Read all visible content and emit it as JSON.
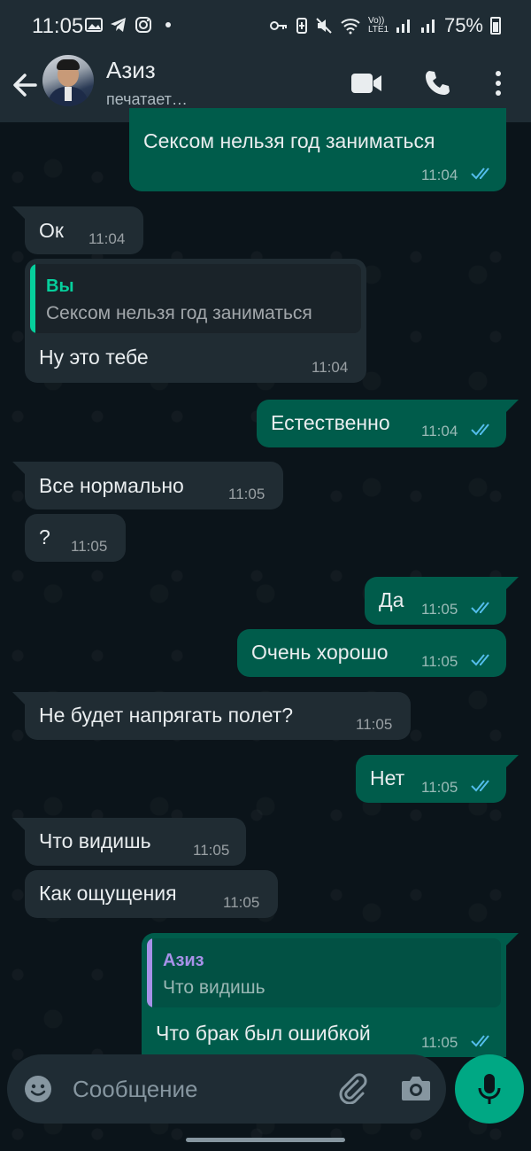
{
  "status_bar": {
    "time": "11:05",
    "battery": "75%",
    "network": "Vo)) LTE1"
  },
  "header": {
    "contact_name": "Азиз",
    "contact_status": "печатает…"
  },
  "messages": [
    {
      "dir": "out",
      "text": "Сексом нельзя год заниматься",
      "time": "11:04",
      "read": true
    },
    {
      "dir": "in",
      "text": "Ок",
      "time": "11:04"
    },
    {
      "dir": "in",
      "quote_name": "Вы",
      "quote_text": "Сексом нельзя год заниматься",
      "text": "Ну это тебе",
      "time": "11:04"
    },
    {
      "dir": "out",
      "text": "Естественно",
      "time": "11:04",
      "read": true
    },
    {
      "dir": "in",
      "text": "Все нормально",
      "time": "11:05"
    },
    {
      "dir": "in",
      "text": "?",
      "time": "11:05"
    },
    {
      "dir": "out",
      "text": "Да",
      "time": "11:05",
      "read": true
    },
    {
      "dir": "out",
      "text": "Очень хорошо",
      "time": "11:05",
      "read": true
    },
    {
      "dir": "in",
      "text": "Не будет напрягать полет?",
      "time": "11:05"
    },
    {
      "dir": "out",
      "text": "Нет",
      "time": "11:05",
      "read": true
    },
    {
      "dir": "in",
      "text": "Что видишь",
      "time": "11:05"
    },
    {
      "dir": "in",
      "text": "Как ощущения",
      "time": "11:05"
    },
    {
      "dir": "out",
      "quote_name": "Азиз",
      "quote_text": "Что видишь",
      "text": "Что брак был ошибкой",
      "time": "11:05",
      "read": true
    }
  ],
  "composer": {
    "placeholder": "Сообщение"
  },
  "colors": {
    "background": "#0b141a",
    "header": "#1f2c34",
    "incoming_bubble": "#202c33",
    "outgoing_bubble": "#005c4b",
    "accent": "#00a884",
    "read_ticks": "#53bdeb",
    "quote_you": "#06cf9c",
    "quote_contact": "#a791e8"
  },
  "icons": [
    "back-arrow-icon",
    "video-call-icon",
    "phone-icon",
    "more-vert-icon",
    "emoji-icon",
    "attach-icon",
    "camera-icon",
    "mic-icon"
  ]
}
